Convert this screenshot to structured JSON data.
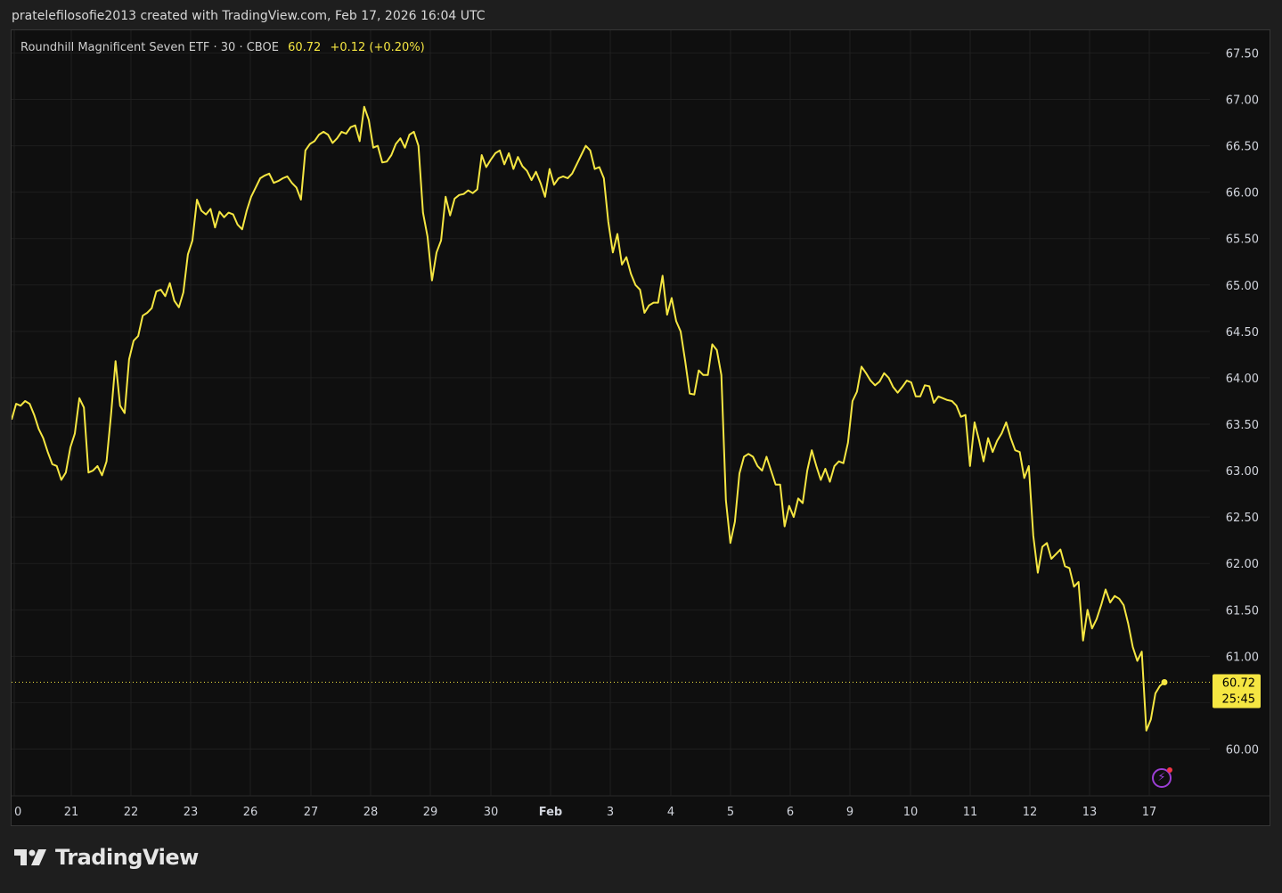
{
  "header": {
    "attribution": "pratelefilosofie2013 created with TradingView.com, Feb 17, 2026 16:04 UTC"
  },
  "legend": {
    "symbol": "Roundhill Magnificent Seven ETF · 30 · CBOE",
    "last": "60.72",
    "change": "+0.12 (+0.20%)"
  },
  "price_label": {
    "price": "60.72",
    "countdown": "25:45"
  },
  "brand": {
    "name": "TradingView"
  },
  "colors": {
    "line": "#f5e642",
    "background": "#0f0f0f",
    "grid": "#1f1f1f",
    "axis_text": "#d1d4dc",
    "alert_icon": "#9c3fd6"
  },
  "icons": [
    "lightning-alert-icon",
    "tradingview-logo-icon"
  ],
  "chart_data": {
    "type": "line",
    "title": "Roundhill Magnificent Seven ETF · 30 · CBOE",
    "xlabel": "",
    "ylabel": "",
    "ylim": [
      59.5,
      67.75
    ],
    "yticks": [
      60.0,
      60.5,
      61.0,
      61.5,
      62.0,
      62.5,
      63.0,
      63.5,
      64.0,
      64.5,
      65.0,
      65.5,
      66.0,
      66.5,
      67.0,
      67.5
    ],
    "xticks": [
      "0",
      "21",
      "22",
      "23",
      "26",
      "27",
      "28",
      "29",
      "30",
      "Feb",
      "3",
      "4",
      "5",
      "6",
      "9",
      "10",
      "11",
      "12",
      "13",
      "17"
    ],
    "grid": true,
    "legend": "top-left",
    "last_price": 60.72,
    "series": [
      {
        "values": [
          63.55,
          63.72,
          63.7,
          63.75,
          63.72,
          63.6,
          63.45,
          63.35,
          63.2,
          63.07,
          63.05,
          62.9,
          62.98,
          63.25,
          63.4,
          63.78,
          63.68,
          62.98,
          63.0,
          63.05,
          62.95,
          63.1,
          63.6,
          64.18,
          63.7,
          63.62,
          64.2,
          64.4,
          64.45,
          64.67,
          64.7,
          64.75,
          64.93,
          64.95,
          64.88,
          65.02,
          64.83,
          64.76,
          64.92,
          65.33,
          65.48,
          65.92,
          65.8,
          65.76,
          65.82,
          65.62,
          65.79,
          65.73,
          65.78,
          65.76,
          65.65,
          65.6,
          65.8,
          65.95,
          66.05,
          66.15,
          66.18,
          66.2,
          66.1,
          66.12,
          66.15,
          66.17,
          66.1,
          66.05,
          65.92,
          66.45,
          66.52,
          66.55,
          66.62,
          66.65,
          66.62,
          66.53,
          66.58,
          66.65,
          66.63,
          66.7,
          66.72,
          66.55,
          66.92,
          66.78,
          66.48,
          66.5,
          66.32,
          66.33,
          66.4,
          66.52,
          66.58,
          66.48,
          66.62,
          66.65,
          66.5,
          65.78,
          65.52,
          65.05,
          65.35,
          65.48,
          65.95,
          65.75,
          65.93,
          65.97,
          65.98,
          66.02,
          65.99,
          66.03,
          66.4,
          66.27,
          66.35,
          66.42,
          66.45,
          66.3,
          66.42,
          66.25,
          66.38,
          66.28,
          66.23,
          66.13,
          66.22,
          66.1,
          65.95,
          66.25,
          66.08,
          66.15,
          66.17,
          66.15,
          66.2,
          66.3,
          66.4,
          66.5,
          66.45,
          66.25,
          66.27,
          66.15,
          65.68,
          65.35,
          65.55,
          65.22,
          65.3,
          65.12,
          65.0,
          64.95,
          64.7,
          64.78,
          64.81,
          64.81,
          65.1,
          64.68,
          64.86,
          64.61,
          64.5,
          64.18,
          63.83,
          63.82,
          64.08,
          64.03,
          64.03,
          64.36,
          64.3,
          64.03,
          62.68,
          62.22,
          62.45,
          62.97,
          63.15,
          63.18,
          63.15,
          63.05,
          63.0,
          63.15,
          63.0,
          62.85,
          62.85,
          62.4,
          62.62,
          62.5,
          62.7,
          62.65,
          63.0,
          63.22,
          63.05,
          62.9,
          63.02,
          62.88,
          63.05,
          63.1,
          63.08,
          63.3,
          63.75,
          63.85,
          64.12,
          64.05,
          63.97,
          63.92,
          63.96,
          64.05,
          64.0,
          63.9,
          63.84,
          63.9,
          63.97,
          63.95,
          63.8,
          63.8,
          63.92,
          63.91,
          63.73,
          63.8,
          63.78,
          63.76,
          63.75,
          63.7,
          63.58,
          63.6,
          63.05,
          63.52,
          63.33,
          63.1,
          63.35,
          63.2,
          63.32,
          63.4,
          63.52,
          63.35,
          63.22,
          63.2,
          62.92,
          63.05,
          62.3,
          61.9,
          62.18,
          62.22,
          62.05,
          62.1,
          62.15,
          61.97,
          61.95,
          61.75,
          61.8,
          61.17,
          61.5,
          61.3,
          61.4,
          61.55,
          61.72,
          61.58,
          61.65,
          61.62,
          61.55,
          61.35,
          61.1,
          60.95,
          61.05,
          60.2,
          60.32,
          60.6,
          60.68,
          60.72
        ]
      }
    ]
  }
}
